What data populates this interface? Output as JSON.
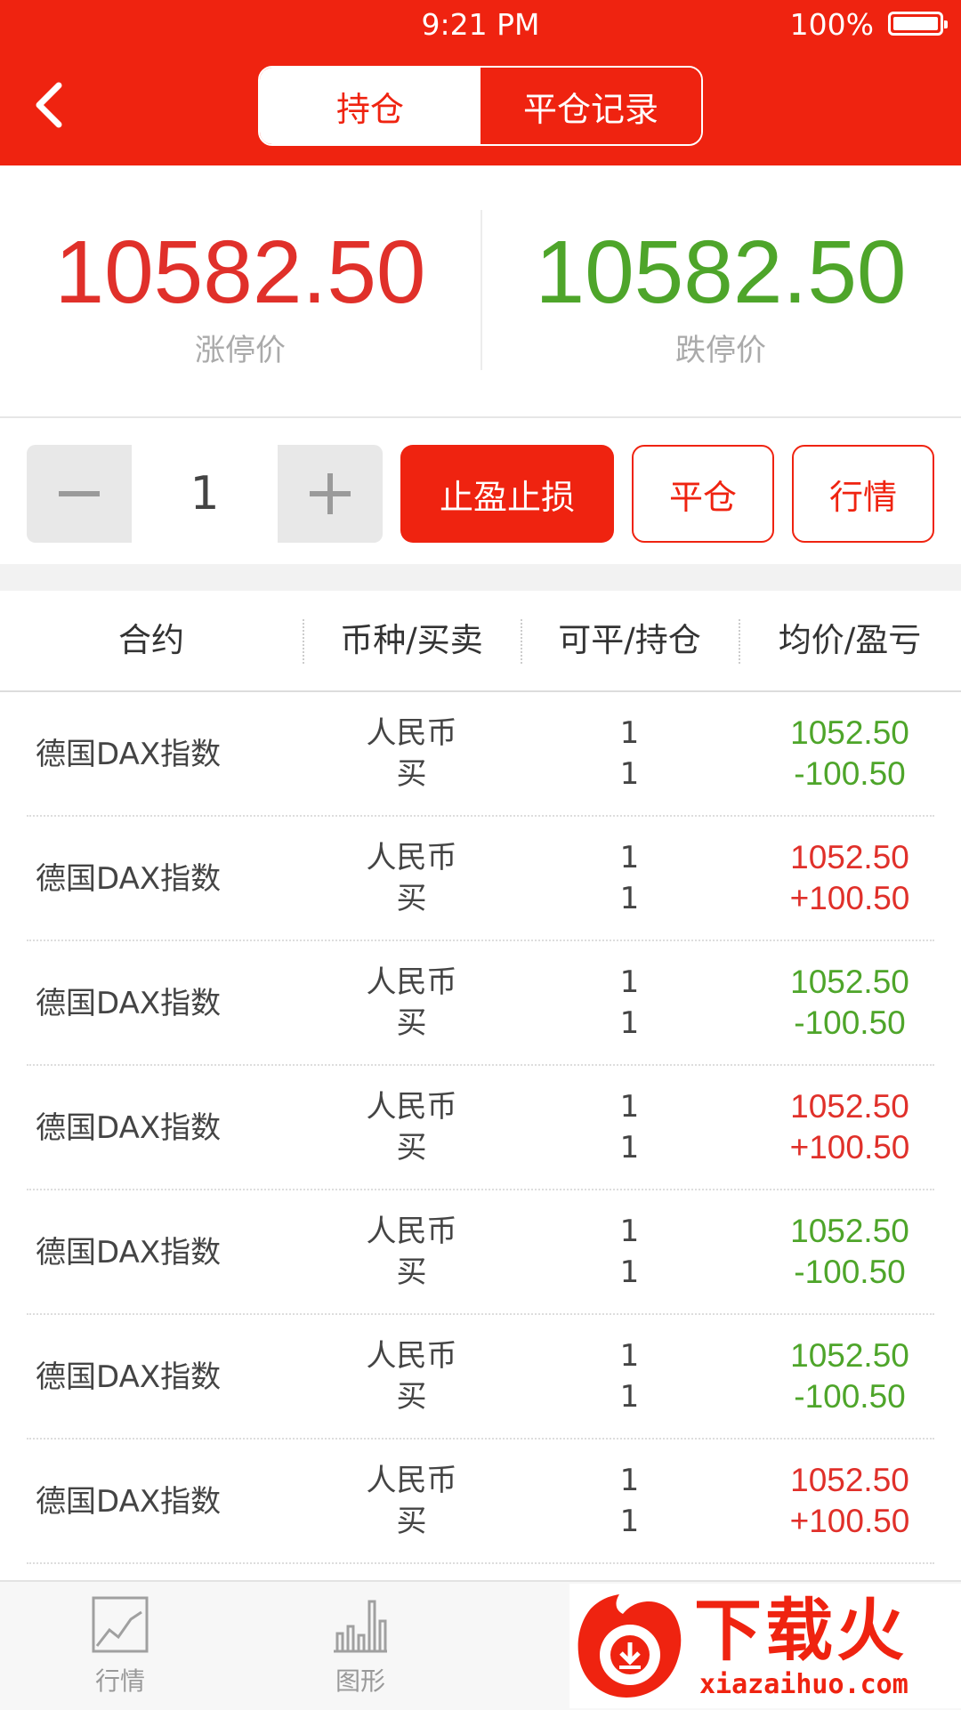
{
  "status": {
    "time": "9:21 PM",
    "battery": "100%"
  },
  "nav": {
    "tabs": [
      {
        "label": "持仓"
      },
      {
        "label": "平仓记录"
      }
    ]
  },
  "prices": {
    "limit_up": {
      "value": "10582.50",
      "label": "涨停价",
      "color": "#e0302a"
    },
    "limit_down": {
      "value": "10582.50",
      "label": "跌停价",
      "color": "#4ea52a"
    }
  },
  "actions": {
    "quantity": "1",
    "take_profit_stop_loss": "止盈止损",
    "close_position": "平仓",
    "market": "行情"
  },
  "table": {
    "headers": [
      "合约",
      "币种/买卖",
      "可平/持仓",
      "均价/盈亏"
    ],
    "rows": [
      {
        "contract": "德国DAX指数",
        "currency": "人民币",
        "side": "买",
        "closable": "1",
        "held": "1",
        "avg_price": "1052.50",
        "pnl": "-100.50",
        "trend": "down"
      },
      {
        "contract": "德国DAX指数",
        "currency": "人民币",
        "side": "买",
        "closable": "1",
        "held": "1",
        "avg_price": "1052.50",
        "pnl": "+100.50",
        "trend": "up"
      },
      {
        "contract": "德国DAX指数",
        "currency": "人民币",
        "side": "买",
        "closable": "1",
        "held": "1",
        "avg_price": "1052.50",
        "pnl": "-100.50",
        "trend": "down"
      },
      {
        "contract": "德国DAX指数",
        "currency": "人民币",
        "side": "买",
        "closable": "1",
        "held": "1",
        "avg_price": "1052.50",
        "pnl": "+100.50",
        "trend": "up"
      },
      {
        "contract": "德国DAX指数",
        "currency": "人民币",
        "side": "买",
        "closable": "1",
        "held": "1",
        "avg_price": "1052.50",
        "pnl": "-100.50",
        "trend": "down"
      },
      {
        "contract": "德国DAX指数",
        "currency": "人民币",
        "side": "买",
        "closable": "1",
        "held": "1",
        "avg_price": "1052.50",
        "pnl": "-100.50",
        "trend": "down"
      },
      {
        "contract": "德国DAX指数",
        "currency": "人民币",
        "side": "买",
        "closable": "1",
        "held": "1",
        "avg_price": "1052.50",
        "pnl": "+100.50",
        "trend": "up"
      }
    ]
  },
  "tabbar": {
    "items": [
      {
        "label": "行情",
        "icon": "line-chart-icon"
      },
      {
        "label": "图形",
        "icon": "bar-chart-icon"
      }
    ]
  },
  "watermark": {
    "title": "下载火",
    "url": "xiazaihuo.com"
  },
  "colors": {
    "brand": "#ef2310",
    "up": "#e0302a",
    "down": "#4ea52a"
  }
}
